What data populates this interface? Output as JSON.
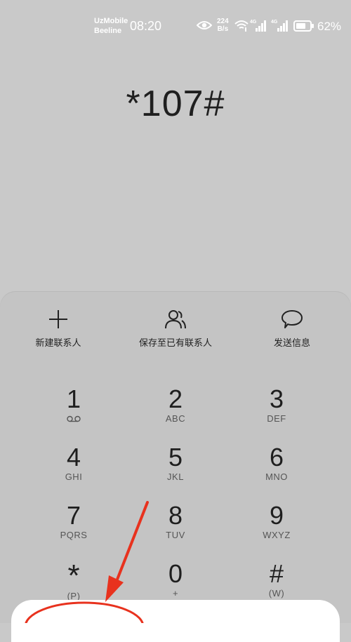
{
  "status_bar": {
    "carrier1": "UzMobile",
    "carrier2": "Beeline",
    "time": "08:20",
    "net_speed_value": "224",
    "net_speed_unit": "B/s",
    "battery": "62%",
    "icons": [
      "eye-icon",
      "wifi-icon",
      "signal-4g-icon",
      "signal-4g-icon",
      "battery-icon"
    ]
  },
  "dialer": {
    "number": "*107#"
  },
  "actions": [
    {
      "label": "新建联系人",
      "icon": "plus-icon"
    },
    {
      "label": "保存至已有联系人",
      "icon": "contacts-icon"
    },
    {
      "label": "发送信息",
      "icon": "message-icon"
    }
  ],
  "keys": [
    {
      "digit": "1",
      "sub": ""
    },
    {
      "digit": "2",
      "sub": "ABC"
    },
    {
      "digit": "3",
      "sub": "DEF"
    },
    {
      "digit": "4",
      "sub": "GHI"
    },
    {
      "digit": "5",
      "sub": "JKL"
    },
    {
      "digit": "6",
      "sub": "MNO"
    },
    {
      "digit": "7",
      "sub": "PQRS"
    },
    {
      "digit": "8",
      "sub": "TUV"
    },
    {
      "digit": "9",
      "sub": "WXYZ"
    },
    {
      "digit": "*",
      "sub": "(P)"
    },
    {
      "digit": "0",
      "sub": "+"
    },
    {
      "digit": "#",
      "sub": "(W)"
    }
  ],
  "colors": {
    "background": "#c9c9c9",
    "panel": "#c4c4c4",
    "annotation": "#e8321e"
  }
}
